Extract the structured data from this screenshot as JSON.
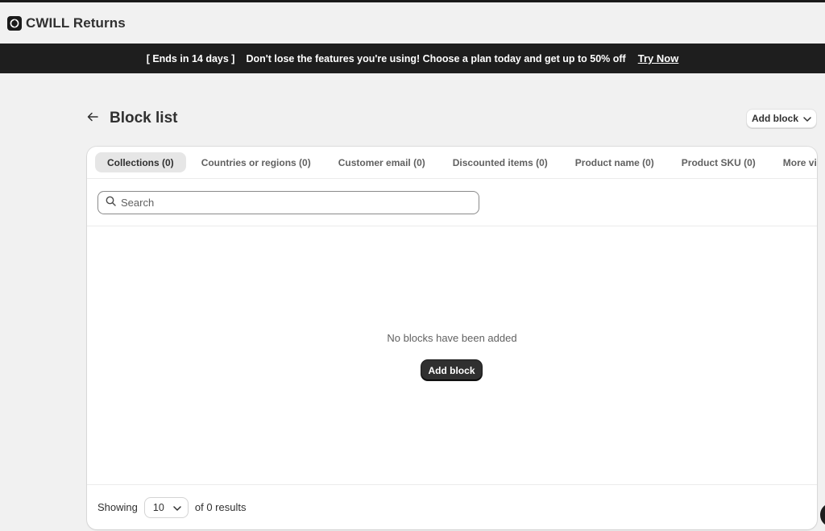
{
  "app": {
    "title": "CWILL Returns",
    "logo_icon": "app-logo-icon"
  },
  "banner": {
    "countdown": "[ Ends in 14 days ]",
    "message": "Don't lose the features you're using! Choose a plan today and get up to 50% off",
    "link_label": "Try Now"
  },
  "page": {
    "title": "Block list",
    "back_icon": "arrow-left-icon",
    "add_block_label": "Add block"
  },
  "tabs": [
    {
      "label": "Collections (0)",
      "active": true
    },
    {
      "label": "Countries or regions (0)",
      "active": false
    },
    {
      "label": "Customer email (0)",
      "active": false
    },
    {
      "label": "Discounted items (0)",
      "active": false
    },
    {
      "label": "Product name (0)",
      "active": false
    },
    {
      "label": "Product SKU (0)",
      "active": false
    },
    {
      "label": "More views",
      "active": false
    }
  ],
  "search": {
    "placeholder": "Search",
    "value": ""
  },
  "empty_state": {
    "message": "No blocks have been added",
    "button_label": "Add block"
  },
  "footer": {
    "showing_label": "Showing",
    "page_size": "10",
    "results_label": "of 0 results"
  },
  "colors": {
    "banner_bg": "#1e1e1e",
    "page_bg": "#f1f1f1",
    "primary_button": "#303030"
  }
}
